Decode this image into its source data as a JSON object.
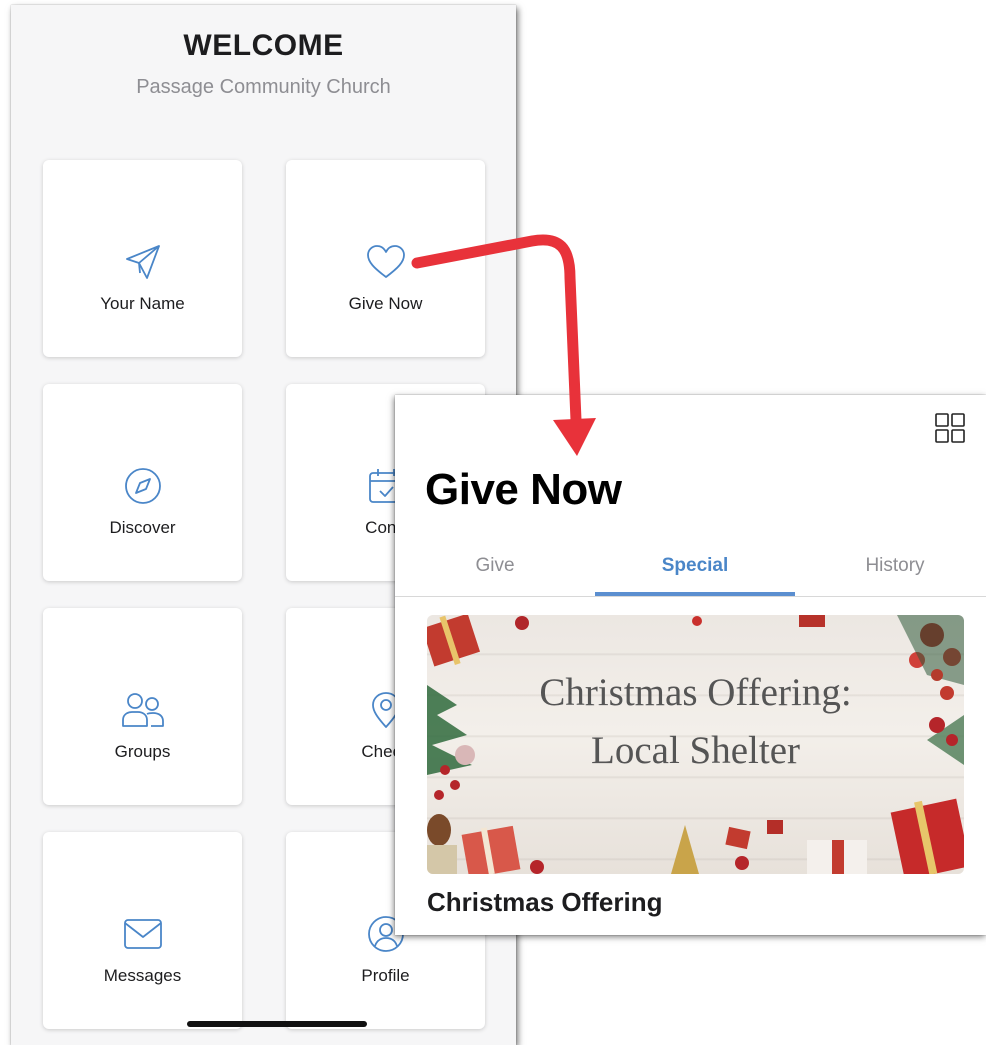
{
  "home": {
    "title": "WELCOME",
    "subtitle": "Passage Community Church",
    "tiles": [
      {
        "label": "Your Name",
        "icon": "paper-plane-icon"
      },
      {
        "label": "Give Now",
        "icon": "heart-icon"
      },
      {
        "label": "Discover",
        "icon": "compass-icon"
      },
      {
        "label": "Conn",
        "icon": "calendar-check-icon"
      },
      {
        "label": "Groups",
        "icon": "users-icon"
      },
      {
        "label": "Check",
        "icon": "map-pin-icon"
      },
      {
        "label": "Messages",
        "icon": "envelope-icon"
      },
      {
        "label": "Profile",
        "icon": "user-circle-icon"
      }
    ]
  },
  "give": {
    "title": "Give Now",
    "grid_icon": "grid-icon",
    "tabs": [
      {
        "label": "Give",
        "active": false
      },
      {
        "label": "Special",
        "active": true
      },
      {
        "label": "History",
        "active": false
      }
    ],
    "banner": {
      "line1": "Christmas Offering:",
      "line2": "Local Shelter"
    },
    "offering_title": "Christmas Offering"
  },
  "colors": {
    "accent": "#4a86c8",
    "icon_stroke": "#4a86c8",
    "arrow": "#e8323a",
    "background": "#f6f6f7"
  }
}
